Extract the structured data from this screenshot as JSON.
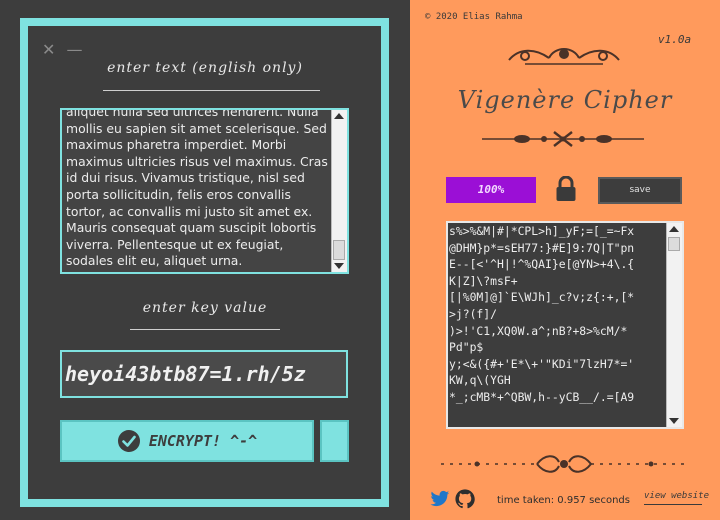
{
  "window_controls": {
    "close_icon": "close-icon",
    "minimize_icon": "minimize-icon"
  },
  "input_section": {
    "heading": "enter text (english only)",
    "text": "aliquet nulla sed ultrices hendrerit. Nulla mollis eu sapien sit amet scelerisque. Sed maximus pharetra imperdiet. Morbi maximus ultricies risus vel maximus. Cras id dui risus. Vivamus tristique, nisl sed porta sollicitudin, felis eros convallis tortor, ac convallis mi justo sit amet ex. Mauris consequat quam suscipit lobortis viverra. Pellentesque ut ex feugiat, sodales elit eu, aliquet urna."
  },
  "key_section": {
    "heading": "enter key value",
    "value": "heyoi43btb87=1.rh/5z"
  },
  "encrypt_button": {
    "label": "ENCRYPT! ^-^",
    "icon": "check-circle-icon"
  },
  "copyright": "© 2020 Elias Rahma",
  "version": "v1.0a",
  "title": "Vigenère Cipher",
  "progress": {
    "label": "100%",
    "value": 1.0
  },
  "lock_icon": "lock-icon",
  "save_button": {
    "label": "save"
  },
  "output": {
    "text": "s%>%&M|#|*CPL>h]_yF;=[_=~Fx\n@DHM}p*=sEH77:}#E]9:7Q|T\"pn\nE--[<'^H|!^%QAI}e[@YN>+4\\.{\nK|Z]\\?msF+\n[|%0M]@]`E\\WJh]_c?v;z{:+,[*\n>j?(f]/\n)>!'C1,XQ0W.a^;nB?+8>%cM/*\nPd\"p$\ny;<&({#+'E*\\+'\"KDi\"7lzH7*='\nKW,q\\(YGH\n*_;cMB*+^QBW,h--yCB__/.=[A9"
  },
  "footer": {
    "twitter_icon": "twitter-icon",
    "github_icon": "github-icon",
    "time_taken": "time taken: 0.957 seconds",
    "view_website": "view website"
  },
  "colors": {
    "accent": "#7fe2e0",
    "panel": "#3d3d3d",
    "right_bg": "#ff9a5c",
    "progress": "#9b0fd6",
    "ornament": "#4a3228"
  }
}
